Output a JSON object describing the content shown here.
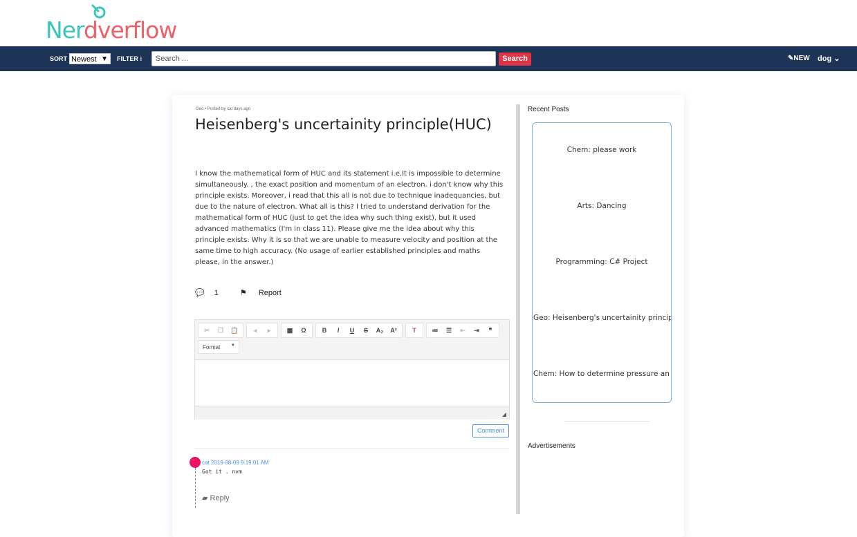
{
  "logo": {
    "part1": "Ner",
    "part2": "d",
    "part3": "verflow"
  },
  "nav": {
    "sort_label": "SORT",
    "sort_value": "Newest",
    "filter_label": "FILTER",
    "search_placeholder": "Search ...",
    "search_button": "Search",
    "new_label": "NEW",
    "user_label": "dog"
  },
  "post": {
    "meta": "Geo • Posted by cat days ago",
    "title": "Heisenberg's uncertainity principle(HUC)",
    "body": "I know the mathematical form of HUC and its statement i.e.It is impossible to determine simultaneously. , the exact position and momentum of an electron. i don't know why this principle exists. Moreover, i read that this all is not due to technique inadequancies, but due to the nature of electron. What all is this? I tried to understand derivation for the mathematical form of HUC (just to get the idea why such thing exist), but it used advanced mathematics (I'm in class 11). Please give me the idea about why this principle exists. Why it is so that we are unable to measure velocity and position at the same time to high accuracy. (No usage of earlier established principles and maths please, in the answer.)",
    "comment_count": "1",
    "report_label": "Report"
  },
  "editor": {
    "format_label": "Format",
    "comment_button": "Comment"
  },
  "comments": [
    {
      "author_time": "cat 2019-08-09 9:19:01 AM",
      "text": "Got it . nvm",
      "reply_label": "Reply",
      "avatar_letter": "-"
    }
  ],
  "sidebar": {
    "recent_title": "Recent Posts",
    "recent_posts": [
      "Chem: please work",
      "Arts: Dancing",
      "Programming: C# Project",
      "Geo: Heisenberg's uncertainity princip",
      "Chem: How to determine pressure an"
    ],
    "ads_title": "Advertisements"
  }
}
